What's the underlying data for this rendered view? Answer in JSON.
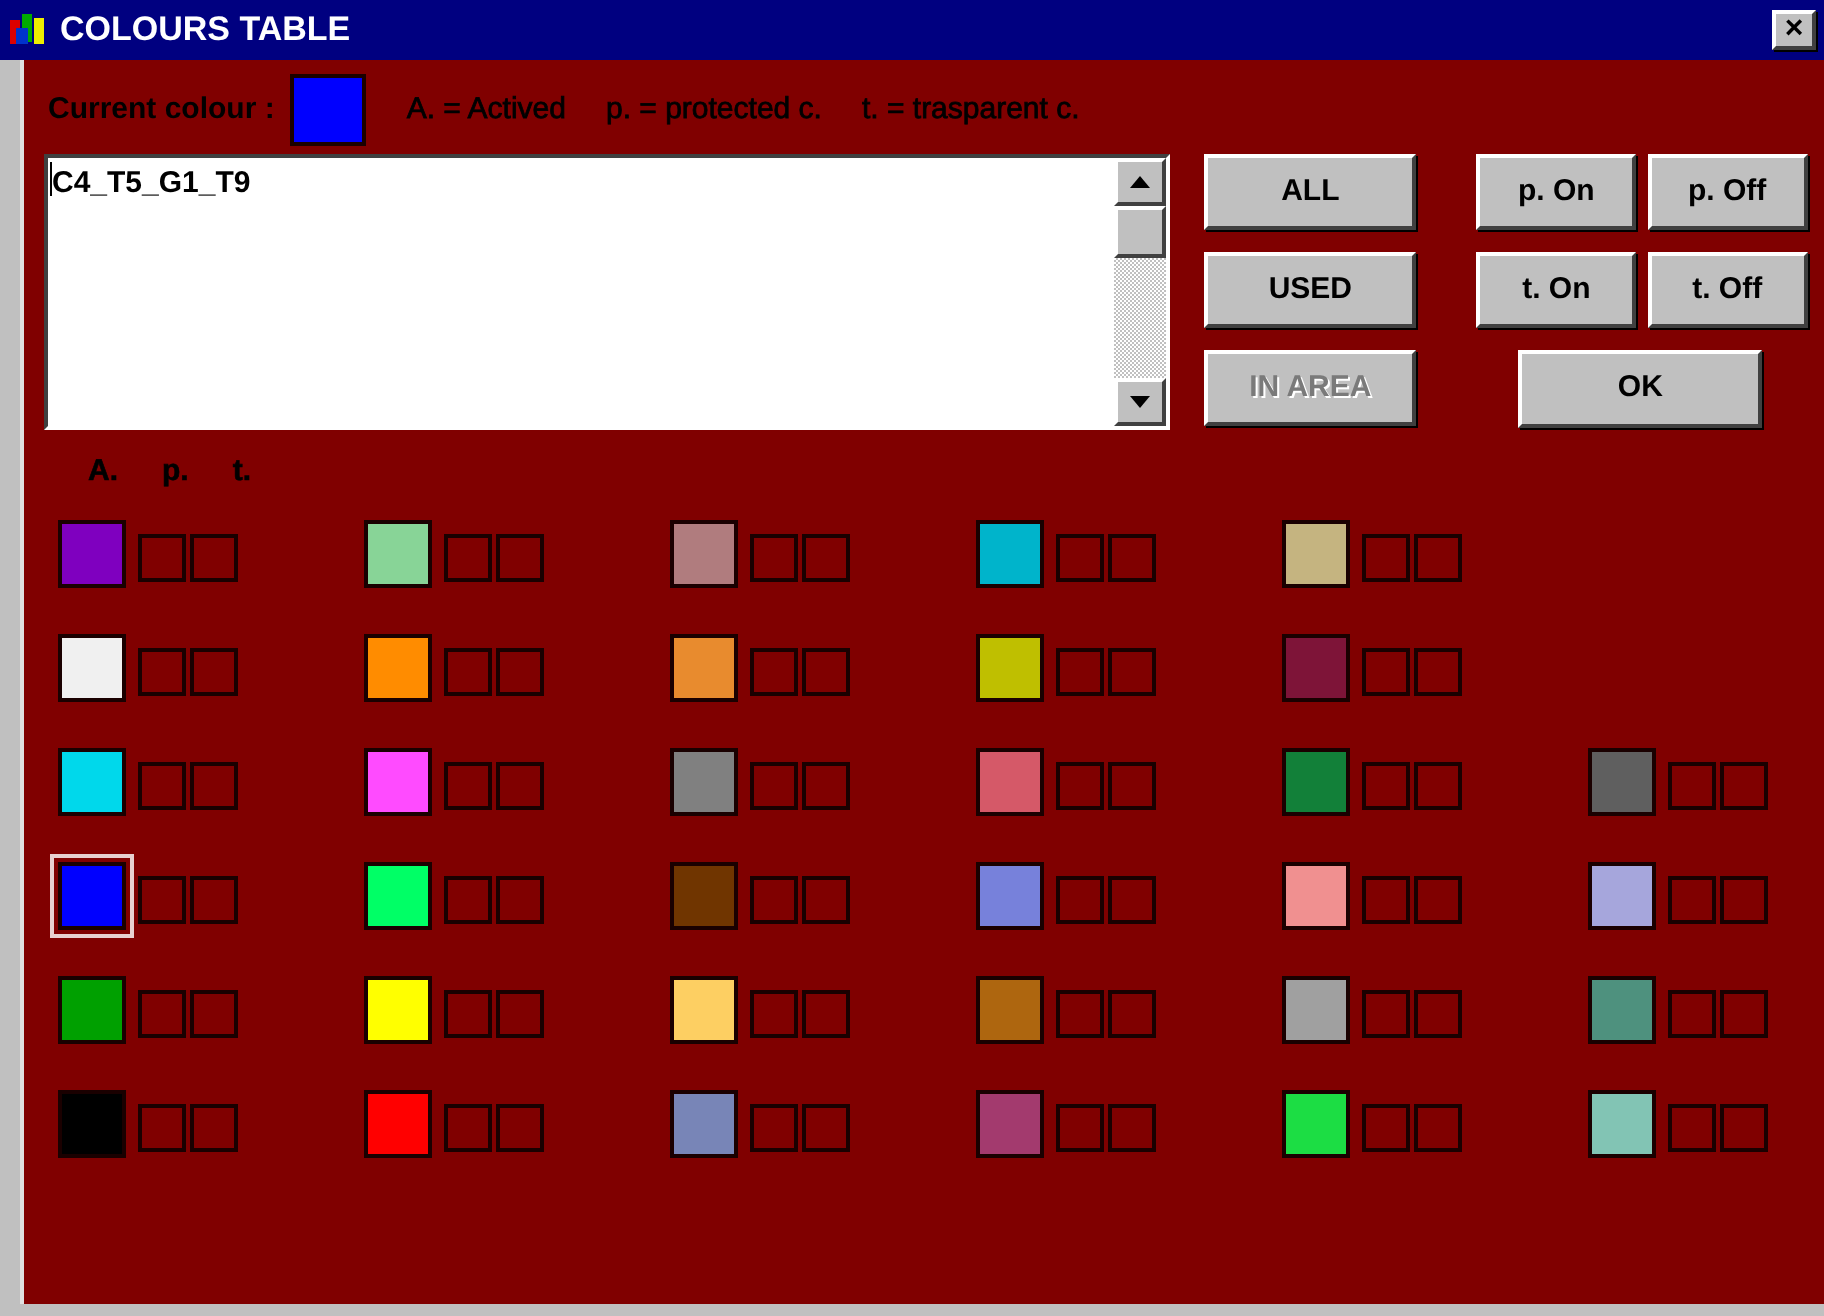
{
  "window": {
    "title": "COLOURS TABLE",
    "close": "×"
  },
  "current_colour": {
    "label": "Current colour :",
    "color": "#0000ff"
  },
  "legend": [
    "A. = Actived",
    "p. = protected c.",
    "t. = trasparent c."
  ],
  "text_box": {
    "value": "C4_T5_G1_T9"
  },
  "buttons": [
    {
      "label": "ALL",
      "disabled": false
    },
    {
      "label": "USED",
      "disabled": false
    },
    {
      "label": "IN AREA",
      "disabled": true
    }
  ],
  "toggle_buttons": [
    {
      "label": "p. On"
    },
    {
      "label": "p. Off"
    },
    {
      "label": "t. On"
    },
    {
      "label": "t. Off"
    }
  ],
  "ok_button": "OK",
  "column_headers": [
    "A.",
    "p.",
    "t."
  ],
  "rows": [
    [
      {
        "color": "#7f00bf",
        "selected": false,
        "protected": false,
        "transparent": false
      },
      {
        "color": "#88d497",
        "selected": false,
        "protected": false,
        "transparent": false
      },
      {
        "color": "#b07c7e",
        "selected": false,
        "protected": false,
        "transparent": false
      },
      {
        "color": "#00b4cb",
        "selected": false,
        "protected": false,
        "transparent": false
      },
      {
        "color": "#c5b480",
        "selected": false,
        "protected": false,
        "transparent": false
      }
    ],
    [
      {
        "color": "#f0f0f0",
        "selected": false,
        "protected": false,
        "transparent": false
      },
      {
        "color": "#ff8c00",
        "selected": false,
        "protected": false,
        "transparent": false
      },
      {
        "color": "#e88b2e",
        "selected": false,
        "protected": false,
        "transparent": false
      },
      {
        "color": "#bfbf00",
        "selected": false,
        "protected": false,
        "transparent": false
      },
      {
        "color": "#7e1438",
        "selected": false,
        "protected": false,
        "transparent": false
      }
    ],
    [
      {
        "color": "#00d8eb",
        "selected": false,
        "protected": false,
        "transparent": false
      },
      {
        "color": "#ff4bff",
        "selected": false,
        "protected": false,
        "transparent": false
      },
      {
        "color": "#808080",
        "selected": false,
        "protected": false,
        "transparent": false
      },
      {
        "color": "#d55968",
        "selected": false,
        "protected": false,
        "transparent": false
      },
      {
        "color": "#128039",
        "selected": false,
        "protected": false,
        "transparent": false
      },
      {
        "color": "#5f5f5f",
        "selected": false,
        "protected": false,
        "transparent": false
      }
    ],
    [
      {
        "color": "#0000ff",
        "selected": true,
        "protected": false,
        "transparent": false
      },
      {
        "color": "#00ff66",
        "selected": false,
        "protected": false,
        "transparent": false
      },
      {
        "color": "#703500",
        "selected": false,
        "protected": false,
        "transparent": false
      },
      {
        "color": "#7781db",
        "selected": false,
        "protected": false,
        "transparent": false
      },
      {
        "color": "#f09090",
        "selected": false,
        "protected": false,
        "transparent": false
      },
      {
        "color": "#a6a6dc",
        "selected": false,
        "protected": false,
        "transparent": false
      }
    ],
    [
      {
        "color": "#00a000",
        "selected": false,
        "protected": false,
        "transparent": false
      },
      {
        "color": "#ffff00",
        "selected": false,
        "protected": false,
        "transparent": false
      },
      {
        "color": "#fdcf62",
        "selected": false,
        "protected": false,
        "transparent": false
      },
      {
        "color": "#ae660f",
        "selected": false,
        "protected": false,
        "transparent": false
      },
      {
        "color": "#a0a0a0",
        "selected": false,
        "protected": false,
        "transparent": false
      },
      {
        "color": "#4e917e",
        "selected": false,
        "protected": false,
        "transparent": false
      }
    ],
    [
      {
        "color": "#000000",
        "selected": false,
        "protected": false,
        "transparent": false
      },
      {
        "color": "#ff0000",
        "selected": false,
        "protected": false,
        "transparent": false
      },
      {
        "color": "#7885b7",
        "selected": false,
        "protected": false,
        "transparent": false
      },
      {
        "color": "#a33a6e",
        "selected": false,
        "protected": false,
        "transparent": false
      },
      {
        "color": "#1cdd44",
        "selected": false,
        "protected": false,
        "transparent": false
      },
      {
        "color": "#82c4b4",
        "selected": false,
        "protected": false,
        "transparent": false
      }
    ]
  ]
}
